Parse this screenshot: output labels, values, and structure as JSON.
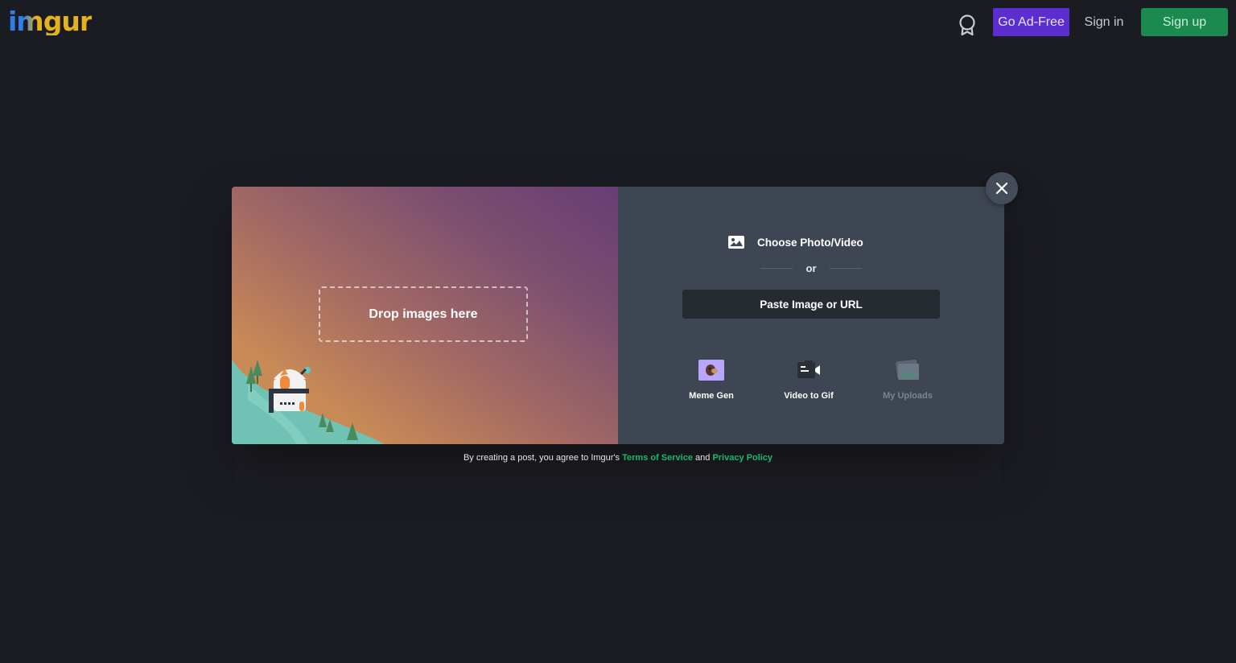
{
  "header": {
    "logo": "imgur",
    "go_ad_free": "Go Ad-Free",
    "sign_in": "Sign in",
    "sign_up": "Sign up"
  },
  "upload": {
    "drop_label": "Drop images here",
    "choose_label": "Choose Photo/Video",
    "or_label": "or",
    "paste_label": "Paste Image or URL",
    "tools": [
      {
        "label": "Meme Gen",
        "icon": "meme-gen-icon"
      },
      {
        "label": "Video to Gif",
        "icon": "video-to-gif-icon"
      },
      {
        "label": "My Uploads",
        "icon": "my-uploads-icon"
      }
    ]
  },
  "terms": {
    "prefix": "By creating a post, you agree to Imgur's",
    "tos": "Terms of Service",
    "and": "and",
    "privacy": "Privacy Policy"
  },
  "colors": {
    "background": "#1b1c22",
    "go_ad_free_bg": "#5c2ecf",
    "sign_up_bg": "#1b8a4e",
    "right_pane_bg": "#3f4653",
    "link_green": "#1bb76e"
  }
}
